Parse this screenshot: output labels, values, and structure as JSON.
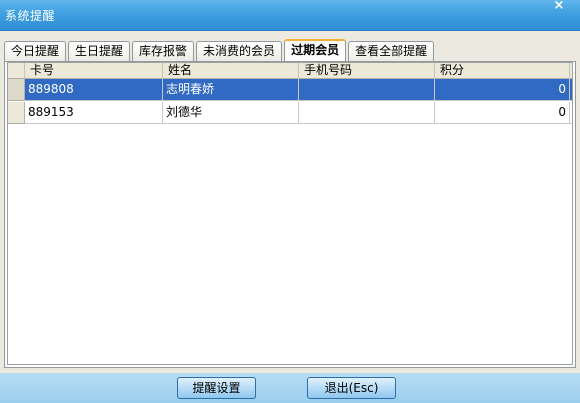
{
  "window": {
    "title": "系统提醒",
    "close": "×"
  },
  "tabs": [
    {
      "label": "今日提醒",
      "active": false
    },
    {
      "label": "生日提醒",
      "active": false
    },
    {
      "label": "库存报警",
      "active": false
    },
    {
      "label": "未消费的会员",
      "active": false
    },
    {
      "label": "过期会员",
      "active": true
    },
    {
      "label": "查看全部提醒",
      "active": false
    }
  ],
  "grid": {
    "columns": [
      "卡号",
      "姓名",
      "手机号码",
      "积分"
    ],
    "rows": [
      {
        "card": "889808",
        "name": "志明春娇",
        "phone": "",
        "points": "0",
        "selected": true
      },
      {
        "card": "889153",
        "name": "刘德华",
        "phone": "",
        "points": "0",
        "selected": false
      }
    ]
  },
  "buttons": {
    "settings": "提醒设置",
    "exit": "退出(Esc)"
  }
}
